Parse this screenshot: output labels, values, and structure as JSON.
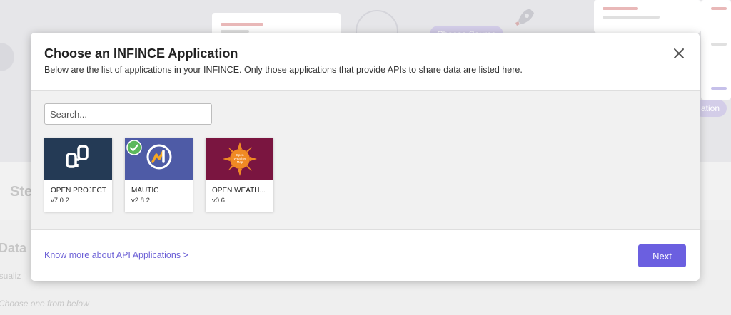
{
  "background": {
    "step_heading": "Ste",
    "data_heading": "Data",
    "visualize_text": "isualiz",
    "choose_text": "Choose one from below",
    "pill_left": "Choose Source",
    "pill_right": "ation"
  },
  "modal": {
    "title": "Choose an INFINCE Application",
    "subtitle": "Below are the list of applications in your INFINCE. Only those applications that provide APIs to share data are listed here.",
    "search": {
      "placeholder": "Search...",
      "value": ""
    },
    "apps": [
      {
        "name": "OPEN PROJECT",
        "version": "v7.0.2",
        "color": "#243a55",
        "icon": "open-project-logo-icon",
        "selected": false
      },
      {
        "name": "MAUTIC",
        "version": "v2.8.2",
        "color": "#4e5ba6",
        "icon": "mautic-logo-icon",
        "selected": true
      },
      {
        "name": "OPEN WEATH...",
        "version": "v0.6",
        "color": "#7a1540",
        "icon": "open-weather-logo-icon",
        "selected": false,
        "logo_text": [
          "Open",
          "Weather",
          "Map"
        ]
      }
    ],
    "footer": {
      "link": "Know more about API Applications >",
      "next_label": "Next"
    }
  },
  "colors": {
    "accent": "#6b5fe0",
    "link": "#6b5fd6",
    "check": "#5cb85c"
  }
}
